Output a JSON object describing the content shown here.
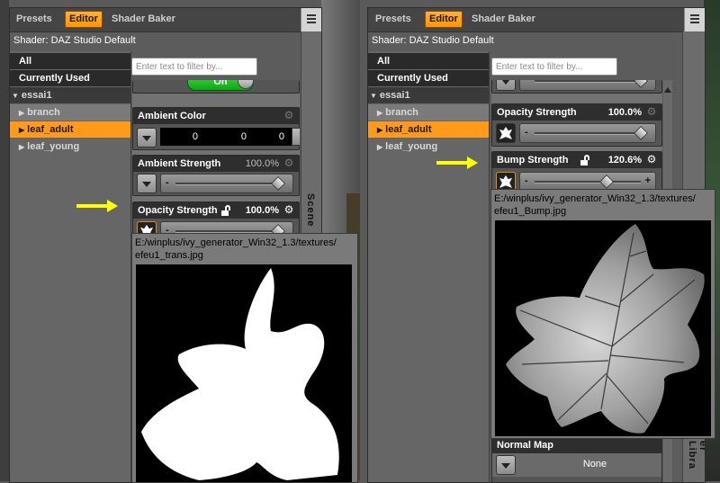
{
  "left": {
    "tabs": [
      "Presets",
      "Editor",
      "Shader Baker"
    ],
    "shader_label": "Shader: DAZ Studio Default",
    "tree": {
      "all": "All",
      "currently_used": "Currently Used",
      "group": "essai1",
      "items": [
        "branch",
        "leaf_adult",
        "leaf_young"
      ]
    },
    "filter_placeholder": "Enter text to filter by...",
    "on_label": "On",
    "ambient_color": {
      "name": "Ambient Color",
      "r": "0",
      "g": "0",
      "b": "0"
    },
    "ambient_strength": {
      "name": "Ambient Strength",
      "value": "100.0%"
    },
    "opacity_strength": {
      "name": "Opacity Strength",
      "value": "100.0%"
    },
    "tooltip_path_1": "E:/winplus/ivy_generator_Win32_1.3/textures/",
    "tooltip_path_2": "efeu1_trans.jpg",
    "scene_label": "Scene"
  },
  "right": {
    "tabs": [
      "Presets",
      "Editor",
      "Shader Baker"
    ],
    "shader_label": "Shader: DAZ Studio Default",
    "tree": {
      "all": "All",
      "currently_used": "Currently Used",
      "group": "essai1",
      "items": [
        "branch",
        "leaf_adult",
        "leaf_young"
      ]
    },
    "filter_placeholder": "Enter text to filter by...",
    "opacity_strength": {
      "name": "Opacity Strength",
      "value": "100.0%"
    },
    "bump_strength": {
      "name": "Bump Strength",
      "value": "120.6%"
    },
    "tooltip_path_1": "E:/winplus/ivy_generator_Win32_1.3/textures/",
    "tooltip_path_2": "efeu1_Bump.jpg",
    "normal_map": {
      "name": "Normal Map",
      "value": "None"
    },
    "side_label": "er Libra"
  },
  "slider_levels": {
    "ambient_strength": 1.0,
    "opacity_strength": 1.0,
    "right_opacity": 1.0,
    "bump_strength": 0.68
  },
  "colors": {
    "accent": "#ff9a1a",
    "pointer": "#ffff00",
    "panel": "#5c5c5c"
  }
}
